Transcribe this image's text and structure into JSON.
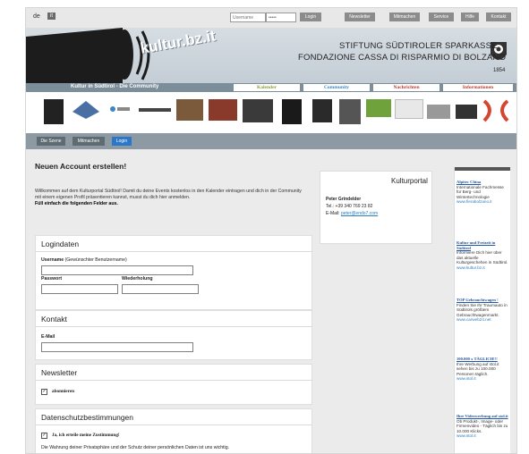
{
  "topbar": {
    "lang": "de",
    "lang_box": "it",
    "username_placeholder": "Username",
    "password_value": "•••••",
    "login": "Login",
    "menu": [
      "Newsletter",
      "Mitmachen",
      "Service",
      "Hilfe",
      "Kontakt"
    ]
  },
  "header": {
    "brand": "kultur.bz.it",
    "bank_line1": "STIFTUNG SÜDTIROLER SPARKASSE",
    "bank_line2": "FONDAZIONE CASSA DI RISPARMIO DI BOLZANO",
    "bank_year": "1854"
  },
  "nav": {
    "community_label": "Kultur in Südtirol - Die Community",
    "tabs": [
      "Kalender",
      "Community",
      "Nachrichten",
      "Informationen"
    ]
  },
  "subnav": [
    "Die Szene",
    "Mitmachen",
    "Login"
  ],
  "main": {
    "title": "Neuen Account erstellen!",
    "intro": "Willkommen auf dem Kulturportal Südtirol! Damit du deine Events kostenlos in den Kalender eintragen und dich in der Community mit einem eigenen Profil präsentieren kannst, musst du dich hier anmelden.",
    "intro_bold": "Füll einfach die folgenden Felder aus.",
    "login_section": {
      "title": "Logindaten",
      "username_label": "Username",
      "username_hint": "(Gewünschter Benutzername)",
      "password_label": "Passwort",
      "repeat_label": "Wiederholung"
    },
    "contact_section": {
      "title": "Kontakt",
      "email_label": "E-Mail"
    },
    "newsletter_section": {
      "title": "Newsletter",
      "checkbox_label": "abonnieren"
    },
    "privacy_section": {
      "title": "Datenschutzbestimmungen",
      "checkbox_label": "Ja, ich erteile meine Zustimmung!",
      "text": "Die Wahrung deiner Privatsphäre und der Schutz deiner persönlichen Daten ist uns wichtig."
    }
  },
  "sidebox": {
    "title": "Kulturportal",
    "name": "Peter Grindelder",
    "phone": "Tel.: +39 340 769 23 82",
    "email_label": "E-Mail:",
    "email": "peter@endo7.com"
  },
  "ads": [
    {
      "title": "Alpitec China",
      "body": "Internationale Fachmesse für Berg- und Wintertechnologie",
      "url": "www.fierabolzano.it"
    },
    {
      "title": "Kultur und Freizeit in Südtirol",
      "body": "Informiere Dich hier über das aktuelle Kulturgeschehen in Südtirol.",
      "url": "www.kultur.bz.it"
    },
    {
      "title": "TOP Gebrauchtwagen !",
      "body": "Finden Sie Ihr Traumauto in Südtirols größtem Gebrauchtwagenmarkt.",
      "url": "www.carweb24.net"
    },
    {
      "title": "100.000 x TÄGLICH!!!",
      "body": "Ihre Werbung auf stol.it sehen bis zu 100.000 Personen täglich.",
      "url": "www.stol.it"
    },
    {
      "title": "Ihre Videowerbung auf stol.it",
      "body": "Ob Produkt-, Image- oder Firmenvideo - Täglich bis zu 10.000 Klicks.",
      "url": "www.stol.it"
    }
  ],
  "colors": {
    "accent_blue": "#2b78c8",
    "nav_grey": "#7d8e9b",
    "tab_kalender": "#8ba236",
    "tab_community": "#3a87c7",
    "tab_nachrichten": "#c0392b",
    "tab_info": "#c0392b"
  }
}
